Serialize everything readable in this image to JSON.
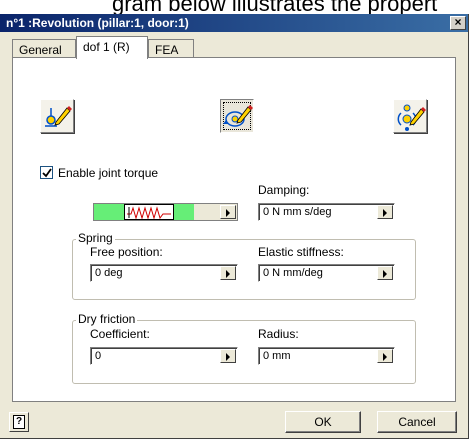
{
  "caption_fragment": "gram below illustrates the propert",
  "window": {
    "title": "n°1 :Revolution (pillar:1, door:1)",
    "close_glyph": "×"
  },
  "tabs": [
    {
      "label": "General",
      "active": false
    },
    {
      "label": "dof 1 (R)",
      "active": true
    },
    {
      "label": "FEA",
      "active": false
    }
  ],
  "mode_buttons": [
    {
      "icon": "joint-edit-icon"
    },
    {
      "icon": "joint-rotation-edit-icon",
      "pressed": true
    },
    {
      "icon": "joint-multi-edit-icon"
    }
  ],
  "joint_torque": {
    "checkbox_label": "Enable joint torque",
    "checked": true,
    "damping_label": "Damping:",
    "damping_value": "0 N mm s/deg"
  },
  "spring": {
    "group_title": "Spring",
    "free_position_label": "Free position:",
    "free_position_value": "0 deg",
    "elastic_stiffness_label": "Elastic stiffness:",
    "elastic_stiffness_value": "0 N mm/deg"
  },
  "dry_friction": {
    "group_title": "Dry friction",
    "coefficient_label": "Coefficient:",
    "coefficient_value": "0",
    "radius_label": "Radius:",
    "radius_value": "0 mm"
  },
  "footer": {
    "help_glyph": "?",
    "ok_label": "OK",
    "cancel_label": "Cancel"
  },
  "colors": {
    "title_gradient_start": "#0a246a",
    "title_gradient_end": "#3a6ea5",
    "dialog_face": "#ece9d8",
    "torque_green": "#66ee77",
    "spring_red": "#d00000"
  }
}
